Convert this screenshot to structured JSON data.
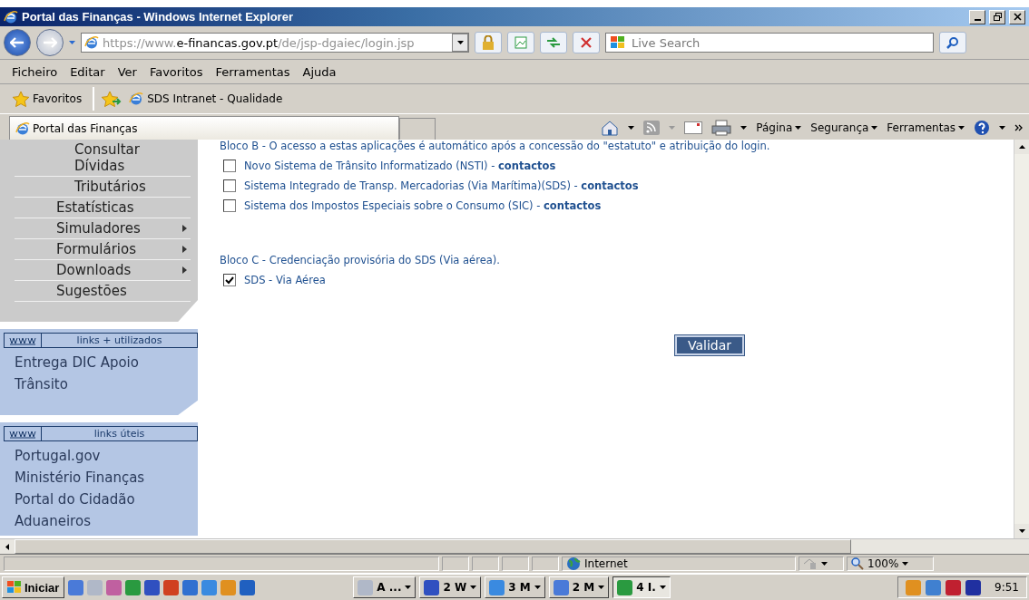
{
  "window": {
    "title": "Portal das Finanças - Windows Internet Explorer"
  },
  "address_bar": {
    "url": "https://www.**e-financas.gov.pt**/de/jsp-dgaiec/login.jsp"
  },
  "search": {
    "placeholder": "Live Search"
  },
  "menu": [
    "Ficheiro",
    "Editar",
    "Ver",
    "Favoritos",
    "Ferramentas",
    "Ajuda"
  ],
  "favorites_bar": {
    "favorites": "Favoritos",
    "links": [
      "SDS Intranet -  Qualidade"
    ]
  },
  "tab": {
    "title": "Portal das Finanças"
  },
  "command_bar": [
    "Página",
    "Segurança",
    "Ferramentas"
  ],
  "sidebar": {
    "menu": [
      {
        "label": "Consultar Dívidas",
        "kind": "subitem",
        "submenu": false
      },
      {
        "label": "Tributários",
        "kind": "subitem",
        "submenu": false
      },
      {
        "label": "Estatísticas",
        "kind": "item",
        "submenu": false
      },
      {
        "label": "Simuladores",
        "kind": "item",
        "submenu": true
      },
      {
        "label": "Formulários",
        "kind": "item",
        "submenu": true
      },
      {
        "label": "Downloads",
        "kind": "item",
        "submenu": true
      },
      {
        "label": "Sugestões",
        "kind": "item",
        "submenu": false
      }
    ],
    "panels": [
      {
        "heading": "links + utilizados",
        "links": [
          "Entrega DIC Apoio",
          "Trânsito"
        ]
      },
      {
        "heading": "links úteis",
        "links": [
          "Portugal.gov",
          "Ministério Finanças",
          "Portal do Cidadão",
          "Aduaneiros"
        ]
      }
    ]
  },
  "content": {
    "blocks": [
      {
        "heading": "Bloco B - O acesso a estas aplicações é automático após a concessão do \"estatuto\" e atribuição do login.",
        "options": [
          {
            "label": "Novo Sistema de Trânsito Informatizado (NSTI) - ",
            "link": "contactos",
            "checked": false
          },
          {
            "label": "Sistema Integrado de Transp. Mercadorias (Via Marítima)(SDS) - ",
            "link": "contactos",
            "checked": false
          },
          {
            "label": "Sistema dos Impostos Especiais sobre o Consumo (SIC) - ",
            "link": "contactos",
            "checked": false
          }
        ]
      },
      {
        "heading": "Bloco C - Credenciação provisória do SDS (Via aérea).",
        "options": [
          {
            "label": "SDS - Via Aérea",
            "checked": true
          }
        ]
      }
    ],
    "button": "Validar"
  },
  "status_bar": {
    "zone": "Internet",
    "zoom": "100%"
  },
  "taskbar": {
    "start": "Iniciar",
    "tasks": [
      {
        "label": "A ...",
        "selected": false
      },
      {
        "label": "2 W",
        "selected": false
      },
      {
        "label": "3 M",
        "selected": false
      },
      {
        "label": "2 M",
        "selected": false
      },
      {
        "label": "4 I.",
        "selected": true
      }
    ],
    "clock": "9:51"
  }
}
